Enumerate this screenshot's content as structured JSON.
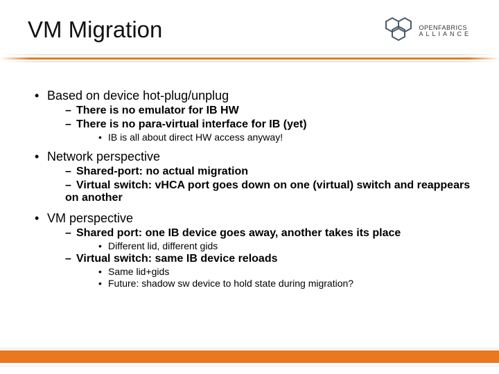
{
  "header": {
    "title": "VM Migration",
    "logo": {
      "top": "OPENFABRICS",
      "bottom": "ALLIANCE"
    }
  },
  "bullets": [
    {
      "level": 0,
      "text": "Based on device hot-plug/unplug"
    },
    {
      "level": 1,
      "bold": true,
      "text": "There is no emulator for IB HW"
    },
    {
      "level": 1,
      "bold": true,
      "text": "There is no para-virtual interface for IB (yet)"
    },
    {
      "level": 2,
      "text": "IB is all about direct HW access anyway!"
    },
    {
      "level": 0,
      "text": "Network perspective"
    },
    {
      "level": 1,
      "bold": true,
      "text": "Shared-port: no actual migration"
    },
    {
      "level": 1,
      "bold": true,
      "text": "Virtual switch: vHCA port goes down on one (virtual) switch and reappears on another"
    },
    {
      "level": 0,
      "text": "VM perspective"
    },
    {
      "level": 1,
      "bold": true,
      "text": "Shared port: one IB device goes away, another takes its place"
    },
    {
      "level": 2,
      "text": "Different lid, different gids"
    },
    {
      "level": 1,
      "bold": true,
      "text": "Virtual switch: same IB device reloads"
    },
    {
      "level": 2,
      "text": "Same lid+gids"
    },
    {
      "level": 2,
      "text": "Future: shadow sw device to hold state during migration?"
    }
  ]
}
